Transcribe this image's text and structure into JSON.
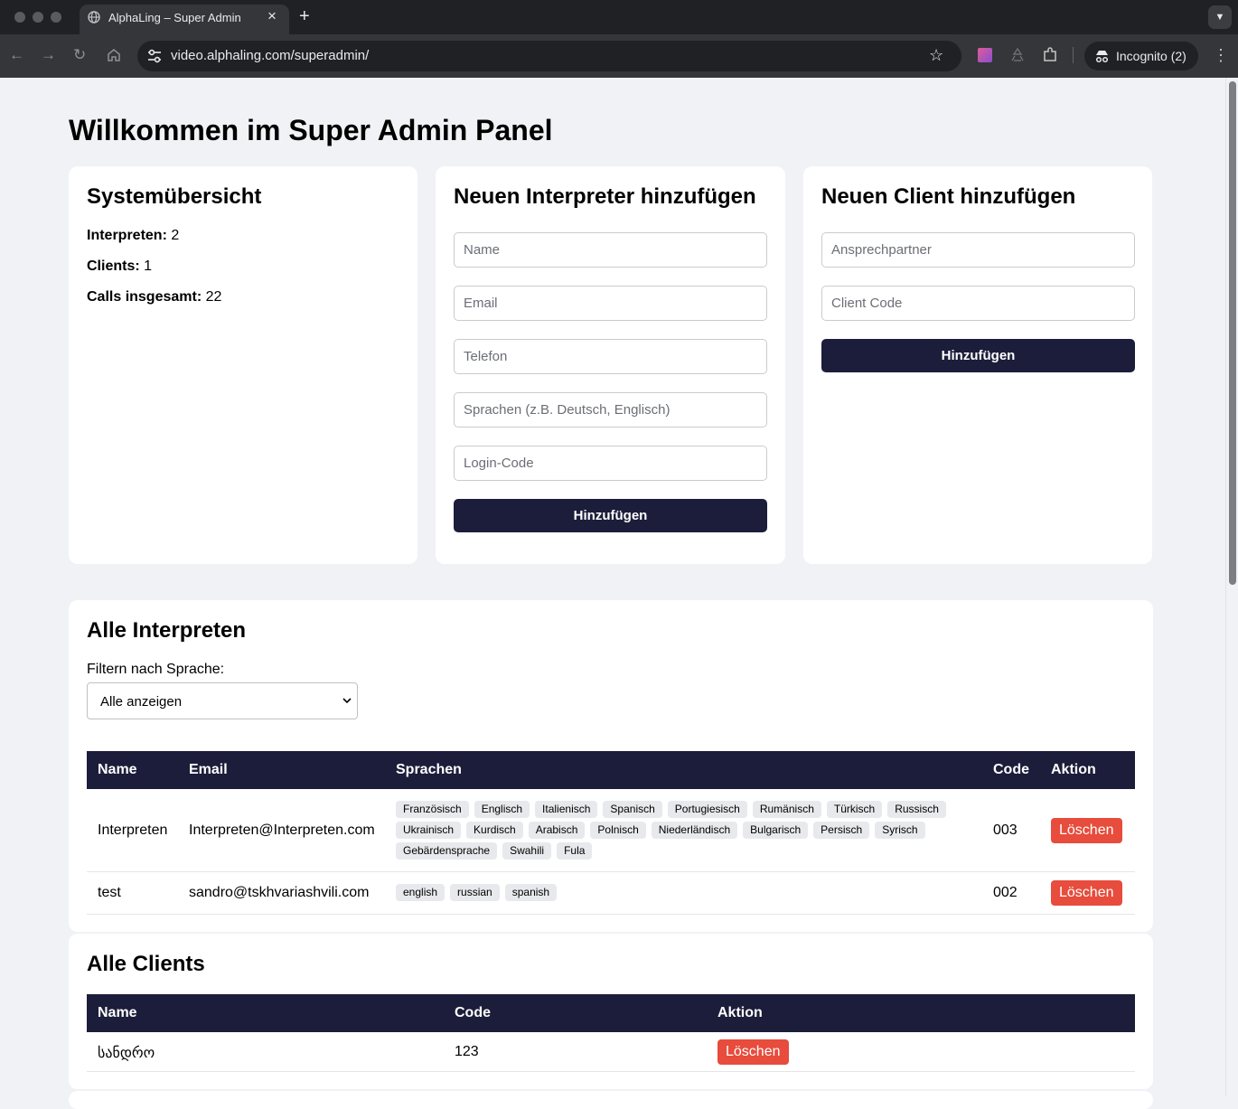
{
  "browser": {
    "tab_title": "AlphaLing – Super Admin",
    "url": "video.alphaling.com/superadmin/",
    "incognito_label": "Incognito (2)"
  },
  "page": {
    "title": "Willkommen im Super Admin Panel"
  },
  "overview": {
    "heading": "Systemübersicht",
    "stats": [
      {
        "label": "Interpreten:",
        "value": "2"
      },
      {
        "label": "Clients:",
        "value": "1"
      },
      {
        "label": "Calls insgesamt:",
        "value": "22"
      }
    ]
  },
  "add_interpreter": {
    "heading": "Neuen Interpreter hinzufügen",
    "placeholders": {
      "name": "Name",
      "email": "Email",
      "phone": "Telefon",
      "languages": "Sprachen (z.B. Deutsch, Englisch)",
      "login_code": "Login-Code"
    },
    "submit_label": "Hinzufügen"
  },
  "add_client": {
    "heading": "Neuen Client hinzufügen",
    "placeholders": {
      "contact": "Ansprechpartner",
      "client_code": "Client Code"
    },
    "submit_label": "Hinzufügen"
  },
  "interpreters": {
    "heading": "Alle Interpreten",
    "filter_label": "Filtern nach Sprache:",
    "filter_selected": "Alle anzeigen",
    "columns": [
      "Name",
      "Email",
      "Sprachen",
      "Code",
      "Aktion"
    ],
    "rows": [
      {
        "name": "Interpreten",
        "email": "Interpreten@Interpreten.com",
        "languages": [
          "Französisch",
          "Englisch",
          "Italienisch",
          "Spanisch",
          "Portugiesisch",
          "Rumänisch",
          "Türkisch",
          "Russisch",
          "Ukrainisch",
          "Kurdisch",
          "Arabisch",
          "Polnisch",
          "Niederländisch",
          "Bulgarisch",
          "Persisch",
          "Syrisch",
          "Gebärdensprache",
          "Swahili",
          "Fula"
        ],
        "code": "003",
        "action": "Löschen"
      },
      {
        "name": "test",
        "email": "sandro@tskhvariashvili.com",
        "languages": [
          "english",
          "russian",
          "spanish"
        ],
        "code": "002",
        "action": "Löschen"
      }
    ]
  },
  "clients": {
    "heading": "Alle Clients",
    "columns": [
      "Name",
      "Code",
      "Aktion"
    ],
    "rows": [
      {
        "name": "სანდრო",
        "code": "123",
        "action": "Löschen"
      }
    ]
  },
  "colors": {
    "navy": "#1c1d3a",
    "danger": "#e74c3c",
    "page_bg": "#f1f2f5"
  }
}
